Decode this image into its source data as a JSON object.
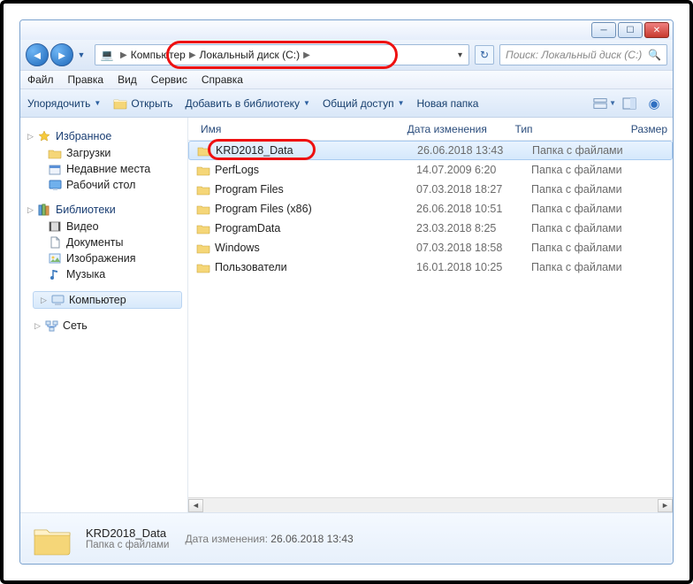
{
  "caption": {
    "min": "—",
    "max": "▢",
    "close": "✕"
  },
  "nav": {
    "breadcrumb": {
      "root_icon": "💻",
      "part1": "Компьютер",
      "part2": "Локальный диск (C:)"
    },
    "search_placeholder": "Поиск: Локальный диск (C:)"
  },
  "menu": {
    "file": "Файл",
    "edit": "Правка",
    "view": "Вид",
    "service": "Сервис",
    "help": "Справка"
  },
  "toolbar": {
    "organize": "Упорядочить",
    "open": "Открыть",
    "addlib": "Добавить в библиотеку",
    "share": "Общий доступ",
    "newfolder": "Новая папка"
  },
  "sidebar": {
    "fav": {
      "hdr": "Избранное",
      "downloads": "Загрузки",
      "recent": "Недавние места",
      "desktop": "Рабочий стол"
    },
    "lib": {
      "hdr": "Библиотеки",
      "video": "Видео",
      "docs": "Документы",
      "img": "Изображения",
      "music": "Музыка"
    },
    "computer": "Компьютер",
    "network": "Сеть"
  },
  "columns": {
    "name": "Имя",
    "date": "Дата изменения",
    "type": "Тип",
    "size": "Размер"
  },
  "rows": [
    {
      "name": "KRD2018_Data",
      "date": "26.06.2018 13:43",
      "type": "Папка с файлами",
      "selected": true
    },
    {
      "name": "PerfLogs",
      "date": "14.07.2009 6:20",
      "type": "Папка с файлами"
    },
    {
      "name": "Program Files",
      "date": "07.03.2018 18:27",
      "type": "Папка с файлами"
    },
    {
      "name": "Program Files (x86)",
      "date": "26.06.2018 10:51",
      "type": "Папка с файлами"
    },
    {
      "name": "ProgramData",
      "date": "23.03.2018 8:25",
      "type": "Папка с файлами"
    },
    {
      "name": "Windows",
      "date": "07.03.2018 18:58",
      "type": "Папка с файлами"
    },
    {
      "name": "Пользователи",
      "date": "16.01.2018 10:25",
      "type": "Папка с файлами"
    }
  ],
  "details": {
    "name": "KRD2018_Data",
    "type": "Папка с файлами",
    "date_label": "Дата изменения:",
    "date": "26.06.2018 13:43"
  }
}
